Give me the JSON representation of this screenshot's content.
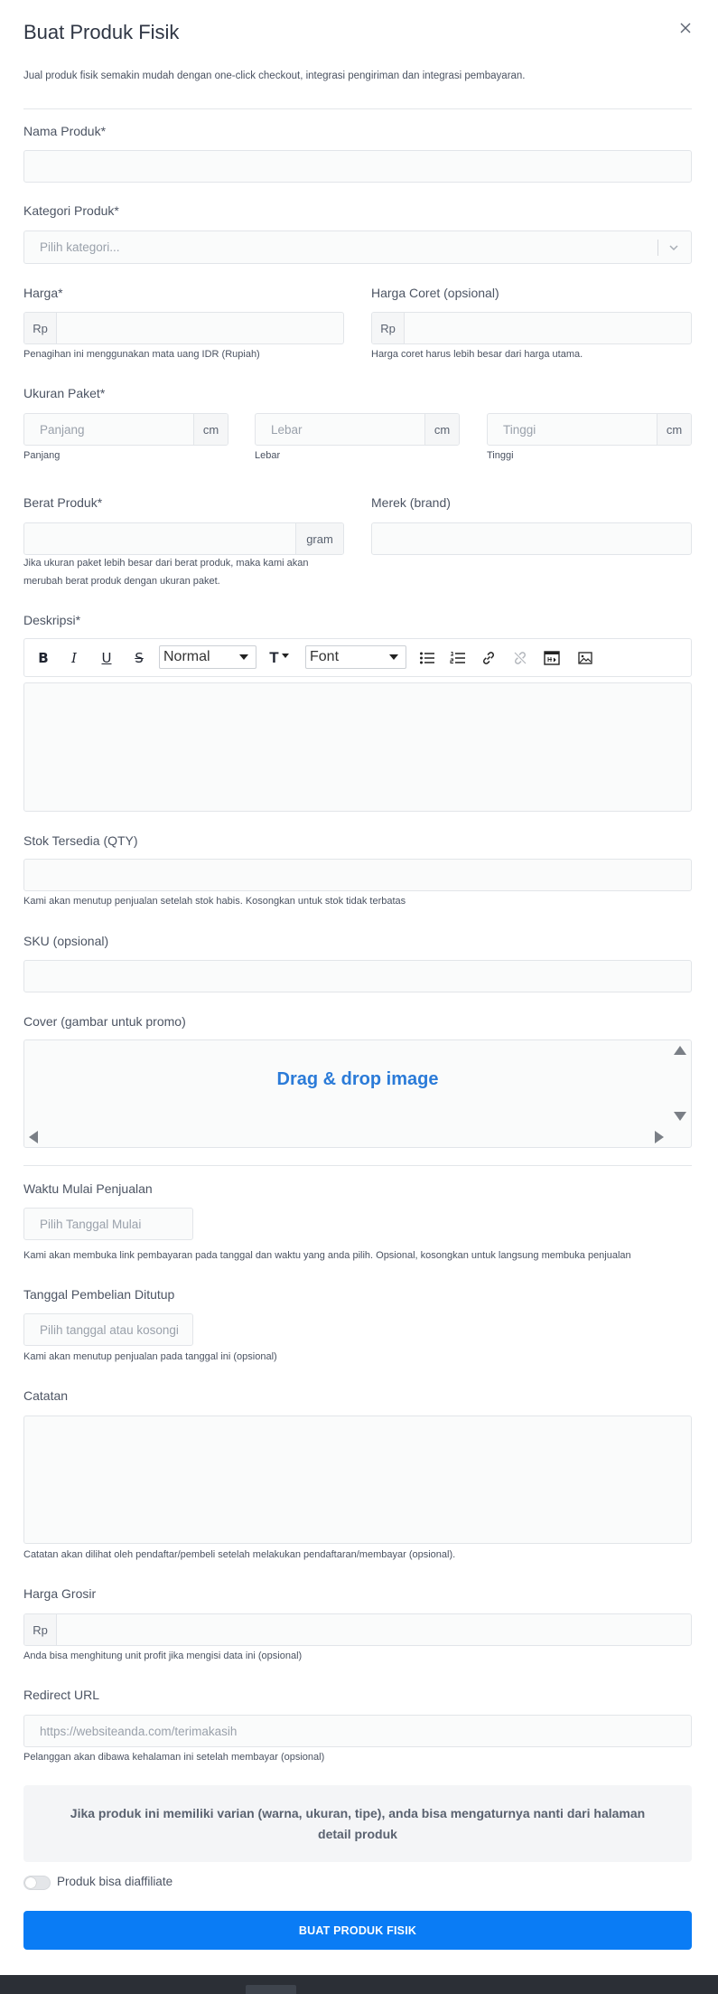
{
  "header": {
    "title": "Buat Produk Fisik",
    "subtitle": "Jual produk fisik semakin mudah dengan one-click checkout, integrasi pengiriman dan integrasi pembayaran."
  },
  "nama_produk": {
    "label": "Nama Produk*",
    "value": ""
  },
  "kategori": {
    "label": "Kategori Produk*",
    "placeholder": "Pilih kategori..."
  },
  "harga": {
    "label": "Harga*",
    "prefix": "Rp",
    "help": "Penagihan ini menggunakan mata uang IDR (Rupiah)"
  },
  "harga_coret": {
    "label": "Harga Coret (opsional)",
    "prefix": "Rp",
    "help": "Harga coret harus lebih besar dari harga utama."
  },
  "ukuran": {
    "label": "Ukuran Paket*",
    "unit": "cm",
    "panjang": {
      "placeholder": "Panjang",
      "help": "Panjang"
    },
    "lebar": {
      "placeholder": "Lebar",
      "help": "Lebar"
    },
    "tinggi": {
      "placeholder": "Tinggi",
      "help": "Tinggi"
    }
  },
  "berat": {
    "label": "Berat Produk*",
    "unit": "gram",
    "help_line1": "Jika ukuran paket lebih besar dari berat produk, maka kami akan",
    "help_line2": "merubah berat produk dengan ukuran paket."
  },
  "merek": {
    "label": "Merek (brand)"
  },
  "deskripsi": {
    "label": "Deskripsi*",
    "toolbar": {
      "bold": "B",
      "italic": "I",
      "underline": "U",
      "strike": "S",
      "heading": "Normal",
      "size_icon": "T",
      "font": "Font"
    }
  },
  "stok": {
    "label": "Stok Tersedia (QTY)",
    "help": "Kami akan menutup penjualan setelah stok habis. Kosongkan untuk stok tidak terbatas"
  },
  "sku": {
    "label": "SKU (opsional)"
  },
  "cover": {
    "label": "Cover (gambar untuk promo)",
    "dropzone": "Drag & drop image"
  },
  "waktu_mulai": {
    "label": "Waktu Mulai Penjualan",
    "placeholder": "Pilih Tanggal Mulai",
    "help": "Kami akan membuka link pembayaran pada tanggal dan waktu yang anda pilih. Opsional, kosongkan untuk langsung membuka penjualan"
  },
  "tanggal_tutup": {
    "label": "Tanggal Pembelian Ditutup",
    "placeholder": "Pilih tanggal atau kosongi",
    "help": "Kami akan menutup penjualan pada tanggal ini (opsional)"
  },
  "catatan": {
    "label": "Catatan",
    "help": "Catatan akan dilihat oleh pendaftar/pembeli setelah melakukan pendaftaran/membayar (opsional)."
  },
  "harga_grosir": {
    "label": "Harga Grosir",
    "prefix": "Rp",
    "help": "Anda bisa menghitung unit profit jika mengisi data ini (opsional)"
  },
  "redirect": {
    "label": "Redirect URL",
    "placeholder": "https://websiteanda.com/terimakasih",
    "help": "Pelanggan akan dibawa kehalaman ini setelah membayar (opsional)"
  },
  "info_varian": "Jika produk ini memiliki varian (warna, ukuran, tipe), anda bisa mengaturnya nanti dari halaman detail produk",
  "affiliate": {
    "label": "Produk bisa diaffiliate",
    "enabled": false
  },
  "submit_label": "BUAT PRODUK FISIK",
  "colors": {
    "primary": "#0a7cf5",
    "link": "#2b7bd8",
    "border": "#e2e5e9",
    "field_bg": "#fafbfb"
  }
}
